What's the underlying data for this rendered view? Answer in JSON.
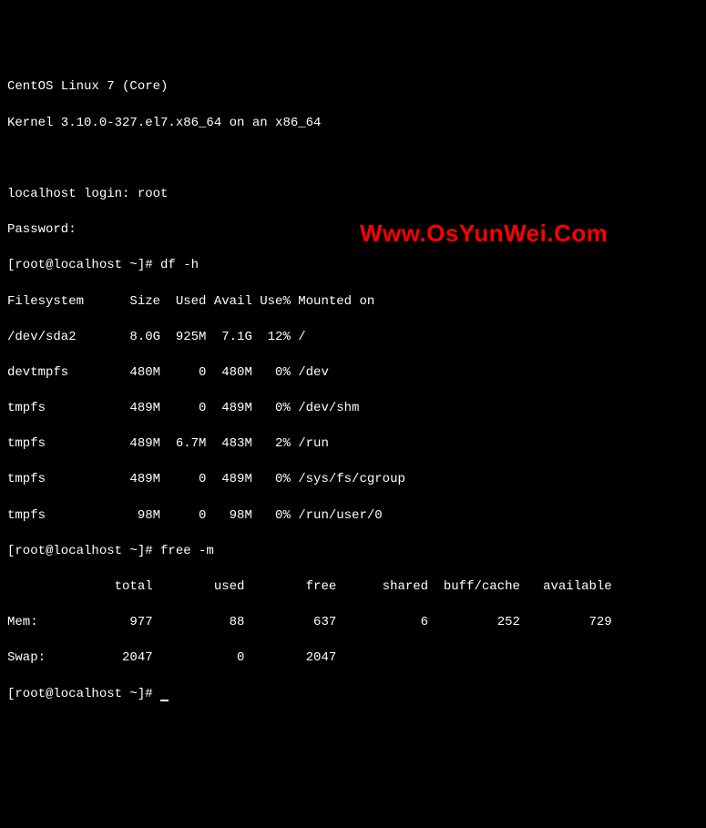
{
  "header": {
    "os_line": "CentOS Linux 7 (Core)",
    "kernel_line": "Kernel 3.10.0-327.el7.x86_64 on an x86_64"
  },
  "login": {
    "login_prompt": "localhost login: root",
    "password_prompt": "Password:"
  },
  "prompts": {
    "p1": "[root@localhost ~]# df -h",
    "p2": "[root@localhost ~]# free -m",
    "p3": "[root@localhost ~]# "
  },
  "df": {
    "header": "Filesystem      Size  Used Avail Use% Mounted on",
    "rows": [
      "/dev/sda2       8.0G  925M  7.1G  12% /",
      "devtmpfs        480M     0  480M   0% /dev",
      "tmpfs           489M     0  489M   0% /dev/shm",
      "tmpfs           489M  6.7M  483M   2% /run",
      "tmpfs           489M     0  489M   0% /sys/fs/cgroup",
      "tmpfs            98M     0   98M   0% /run/user/0"
    ]
  },
  "free": {
    "header": "              total        used        free      shared  buff/cache   available",
    "mem": "Mem:            977          88         637           6         252         729",
    "swap": "Swap:          2047           0        2047"
  },
  "watermark": "Www.OsYunWei.Com"
}
